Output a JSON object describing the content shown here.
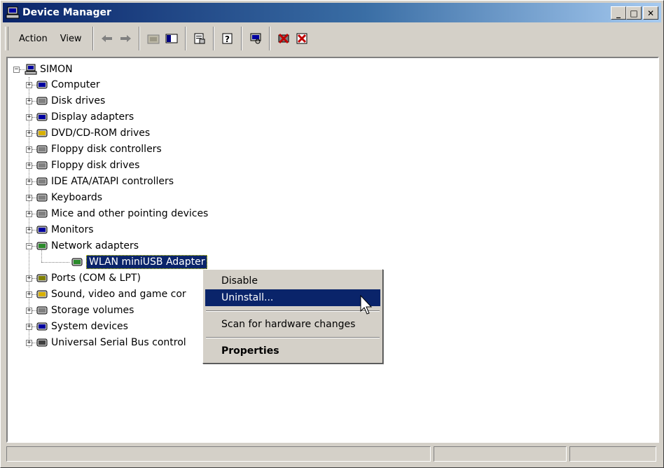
{
  "window": {
    "title": "Device Manager",
    "title_icon": "computer-icon"
  },
  "title_buttons": {
    "minimize": "_",
    "maximize": "□",
    "close": "✕"
  },
  "menu": {
    "action_label": "Action",
    "view_label": "View"
  },
  "toolbar_icons": [
    "back-arrow-icon",
    "forward-arrow-icon",
    "up-folder-icon",
    "show-hide-tree-icon",
    "properties-icon",
    "help-icon",
    "scan-hardware-icon",
    "uninstall-device-icon",
    "disable-device-icon"
  ],
  "tree": {
    "root": "SIMON",
    "categories": [
      "Computer",
      "Disk drives",
      "Display adapters",
      "DVD/CD-ROM drives",
      "Floppy disk controllers",
      "Floppy disk drives",
      "IDE ATA/ATAPI controllers",
      "Keyboards",
      "Mice and other pointing devices",
      "Monitors",
      "Network adapters",
      "WLAN miniUSB Adapter",
      "Ports (COM & LPT)",
      "Sound, video and game cor",
      "Storage volumes",
      "System devices",
      "Universal Serial Bus control"
    ]
  },
  "context_menu": {
    "disable": "Disable",
    "uninstall": "Uninstall...",
    "scan": "Scan for hardware changes",
    "properties": "Properties"
  },
  "colors": {
    "titlebar": "#0a246a",
    "selection": "#0a246a",
    "face": "#d4d0c8"
  }
}
